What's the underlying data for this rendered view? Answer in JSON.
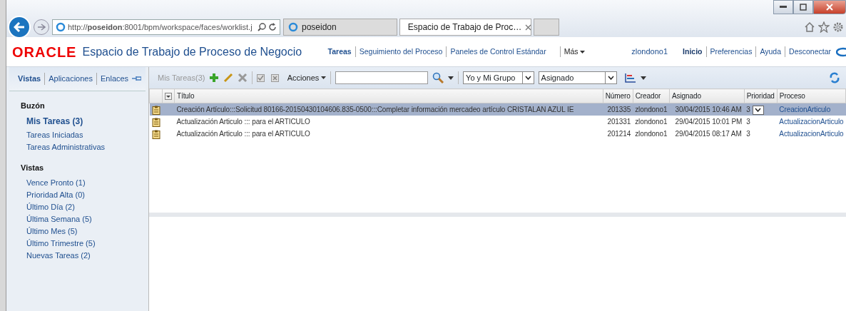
{
  "browser": {
    "address": "http://**poseidon**:8001/bpm/workspace/faces/worklist.j",
    "tabs": [
      {
        "label": "poseidon",
        "selected": false
      },
      {
        "label": "Espacio de Trabajo de Proc…",
        "selected": true
      }
    ]
  },
  "header": {
    "logo": "ORACLE",
    "title": "Espacio de Trabajo de Proceso de Negocio",
    "nav": [
      {
        "label": "Tareas",
        "selected": true
      },
      {
        "label": "Seguimiento del Proceso",
        "selected": false
      },
      {
        "label": "Paneles de Control Estándar",
        "selected": false
      }
    ],
    "more": "Más",
    "user": "zlondono1",
    "links": [
      {
        "label": "Inicio",
        "selected": true
      },
      {
        "label": "Preferencias",
        "selected": false
      },
      {
        "label": "Ayuda",
        "selected": false
      },
      {
        "label": "Desconectar",
        "selected": false
      }
    ]
  },
  "sidebar": {
    "tabs": [
      {
        "label": "Vistas",
        "selected": true
      },
      {
        "label": "Aplicaciones",
        "selected": false
      },
      {
        "label": "Enlaces",
        "selected": false
      }
    ],
    "sections": [
      {
        "heading": "Buzón",
        "items": [
          {
            "label": "Mis Tareas (3)",
            "selected": true
          },
          {
            "label": "Tareas Iniciadas",
            "selected": false
          },
          {
            "label": "Tareas Administrativas",
            "selected": false
          }
        ]
      },
      {
        "heading": "Vistas",
        "items": [
          {
            "label": "Vence Pronto (1)",
            "selected": false
          },
          {
            "label": "Prioridad Alta (0)",
            "selected": false
          },
          {
            "label": "Último Día (2)",
            "selected": false
          },
          {
            "label": "Última Semana (5)",
            "selected": false
          },
          {
            "label": "Último Mes (5)",
            "selected": false
          },
          {
            "label": "Último Trimestre (5)",
            "selected": false
          },
          {
            "label": "Nuevas Tareas (2)",
            "selected": false
          }
        ]
      }
    ]
  },
  "toolbar": {
    "view": "Mis Tareas(3)",
    "actions": "Acciones",
    "filters": [
      "Yo y Mi Grupo",
      "Asignado"
    ]
  },
  "table": {
    "columns": [
      "Título",
      "Número",
      "Creador",
      "Asignado",
      "Prioridad",
      "Proceso"
    ],
    "rows": [
      {
        "selected": true,
        "cells": [
          "Creación Artículo:::Solicitud 80166-20150430104606.835-0500:::Completar información mercadeo artículo CRISTALAN AZUL IE",
          "201335",
          "zlondono1",
          "30/04/2015 10:46 AM",
          "3",
          "CreacionArticulo"
        ]
      },
      {
        "selected": false,
        "cells": [
          "Actualización Articulo ::: para el ARTICULO",
          "201331",
          "zlondono1",
          "29/04/2015 10:01 PM",
          "3",
          "ActualizacionArticulo"
        ]
      },
      {
        "selected": false,
        "cells": [
          "Actualización Articulo ::: para el ARTICULO",
          "201214",
          "zlondono1",
          "29/04/2015 08:17 AM",
          "3",
          "ActualizacionArticulo"
        ]
      }
    ]
  }
}
